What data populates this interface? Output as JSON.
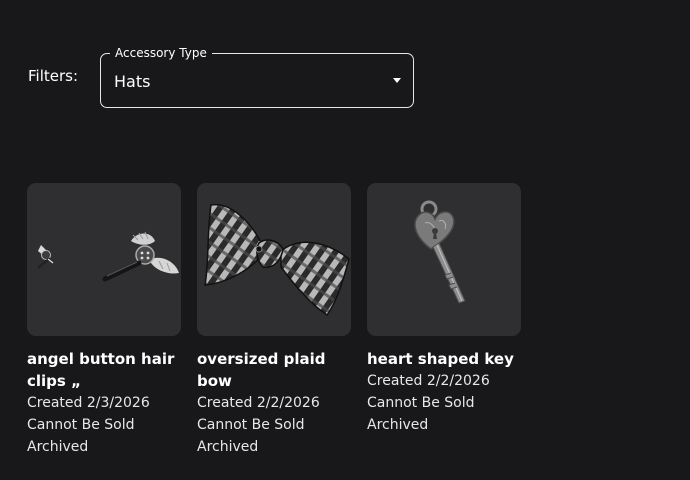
{
  "filters": {
    "label": "Filters:",
    "accessory_type": {
      "legend": "Accessory Type",
      "value": "Hats"
    }
  },
  "items": [
    {
      "name": "angel button hair clips „",
      "created": "Created 2/3/2026",
      "sale_status": "Cannot Be Sold",
      "state": "Archived",
      "icon": "hair-clips-icon"
    },
    {
      "name": "oversized plaid bow",
      "created": "Created 2/2/2026",
      "sale_status": "Cannot Be Sold",
      "state": "Archived",
      "icon": "plaid-bow-icon"
    },
    {
      "name": "heart shaped key",
      "created": "Created 2/2/2026",
      "sale_status": "Cannot Be Sold",
      "state": "Archived",
      "icon": "heart-key-icon"
    }
  ]
}
